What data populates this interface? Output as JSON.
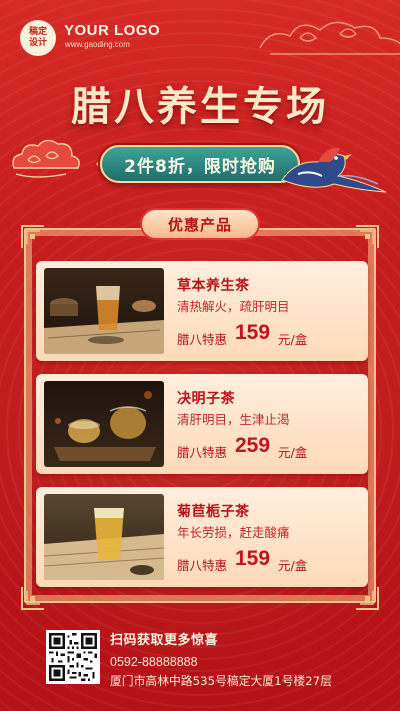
{
  "header": {
    "logo_badge": "稿定\n设计",
    "logo_text": "YOUR LOGO",
    "logo_url": "www.gaoding.com"
  },
  "title": "腊八养生专场",
  "promo": "2件8折，限时抢购",
  "section_label": "优惠产品",
  "products": [
    {
      "name": "草本养生茶",
      "desc": "清热解火，疏肝明目",
      "deal_label": "腊八特惠",
      "price": "159",
      "unit": "元/盒",
      "image": "herbal-tea-photo"
    },
    {
      "name": "决明子茶",
      "desc": "清肝明目，生津止渴",
      "deal_label": "腊八特惠",
      "price": "259",
      "unit": "元/盒",
      "image": "cassia-seed-tea-photo"
    },
    {
      "name": "菊苣栀子茶",
      "desc": "年长劳损，赶走酸痛",
      "deal_label": "腊八特惠",
      "price": "159",
      "unit": "元/盒",
      "image": "chicory-gardenia-tea-photo"
    }
  ],
  "footer": {
    "scan_text": "扫码获取更多惊喜",
    "phone": "0592-88888888",
    "address": "厦门市高林中路535号稿定大厦1号楼27层"
  },
  "colors": {
    "background": "#c41a1d",
    "title": "#ffe8c7",
    "pill": "#2a8580",
    "card": "#ffe6cf",
    "accent_text": "#b9121a",
    "frame": "#f2c389"
  }
}
